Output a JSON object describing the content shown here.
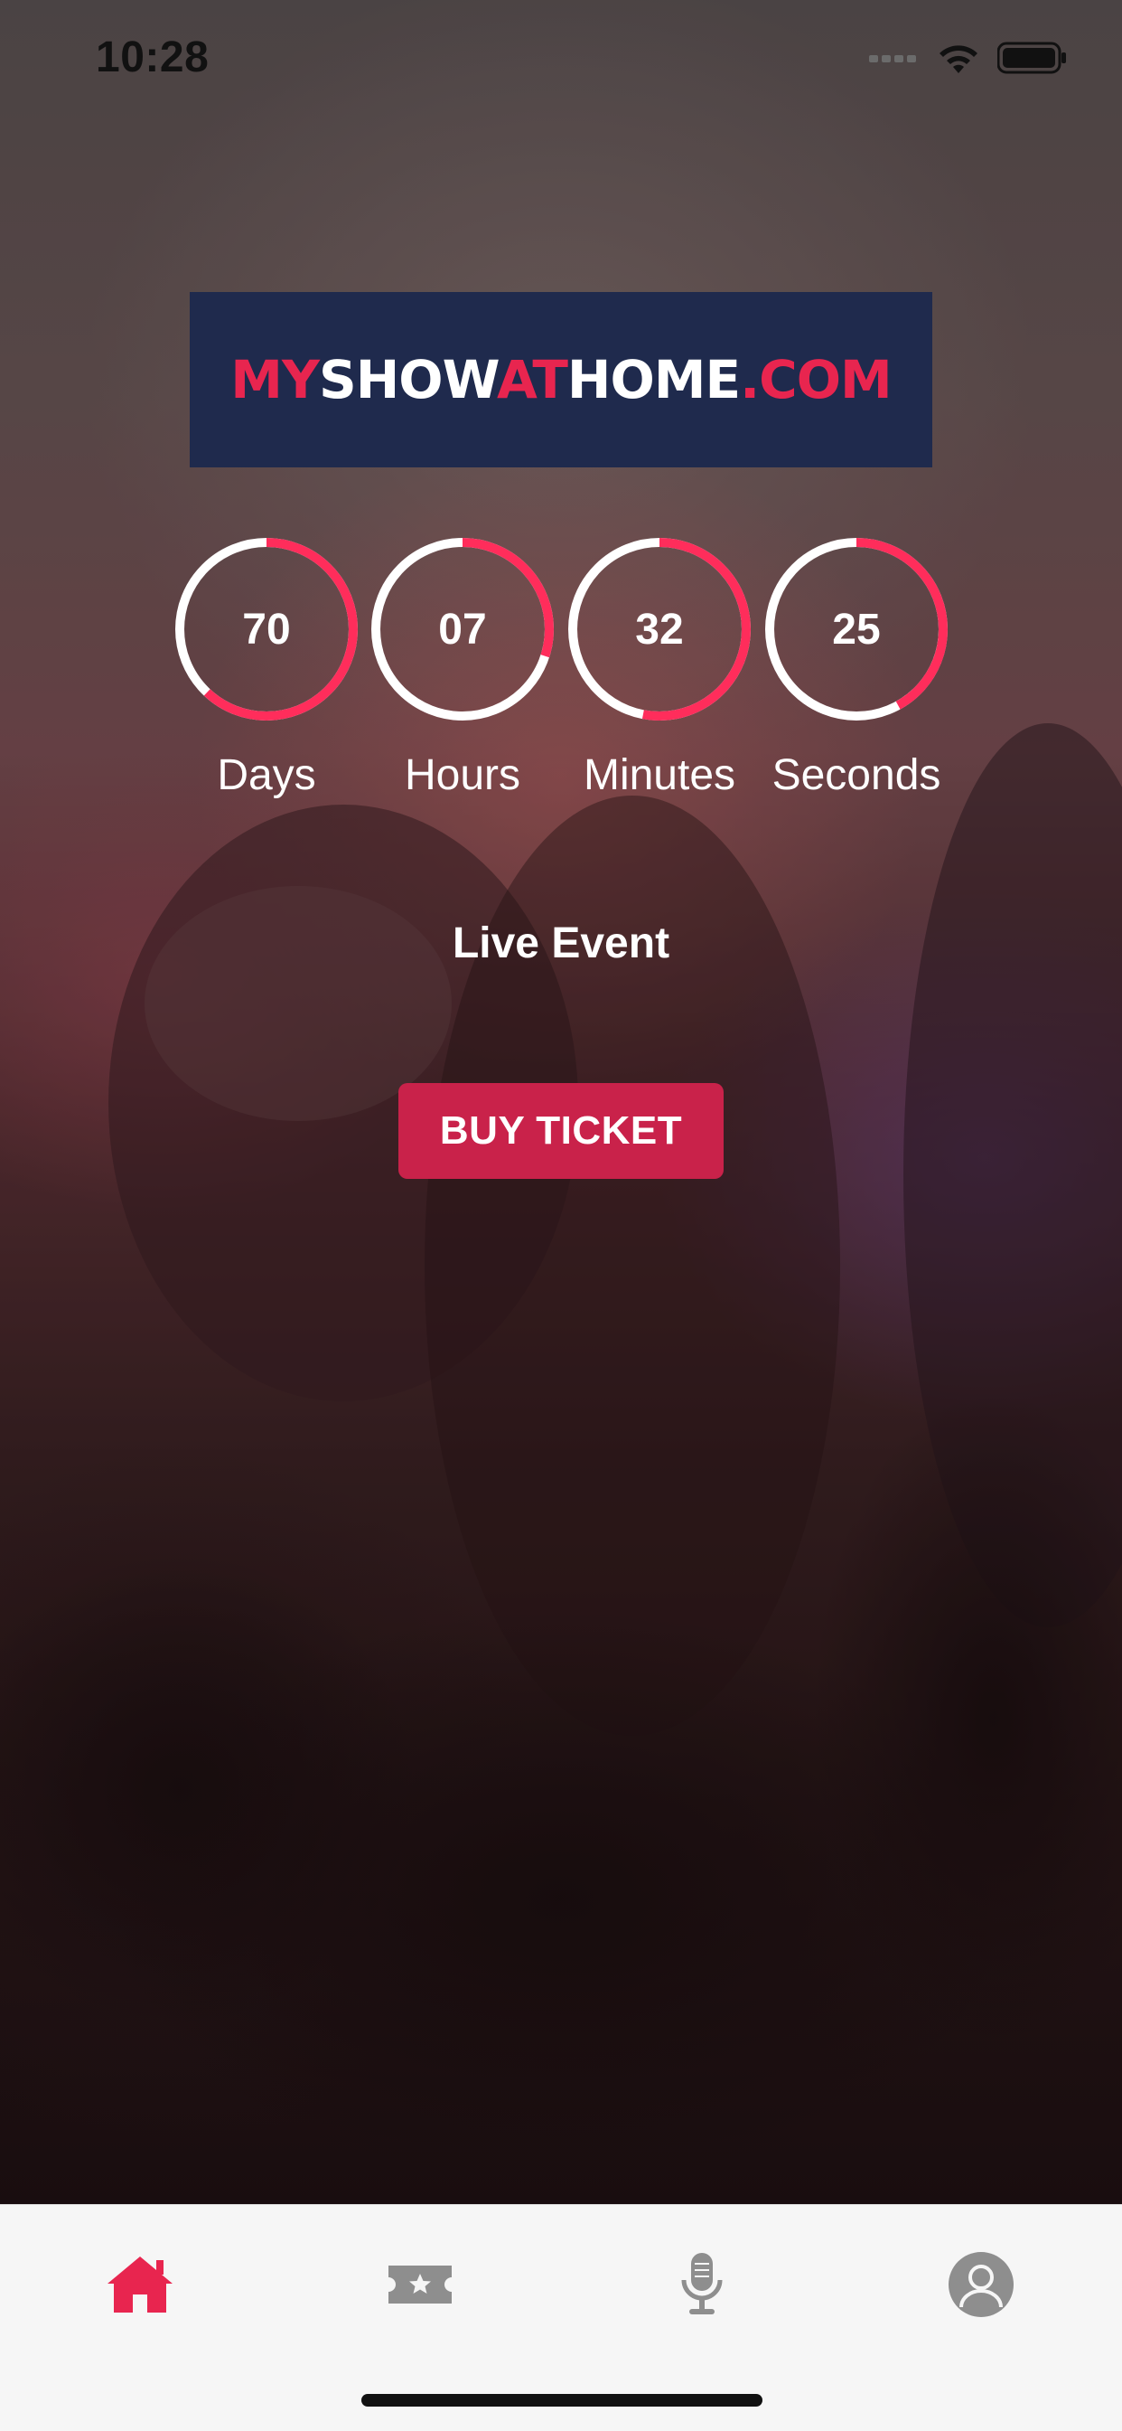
{
  "status_bar": {
    "time": "10:28",
    "icons": [
      "cellular-icon",
      "wifi-icon",
      "battery-icon"
    ]
  },
  "logo": {
    "parts": [
      {
        "text": "MY",
        "color": "#e8254f"
      },
      {
        "text": "SHOW",
        "color": "#ffffff"
      },
      {
        "text": "AT",
        "color": "#e8254f"
      },
      {
        "text": "HOME",
        "color": "#ffffff"
      },
      {
        "text": ".COM",
        "color": "#e8254f"
      }
    ],
    "background": "#1f2a4d"
  },
  "countdown": {
    "days": {
      "value": "70",
      "label": "Days",
      "progress": 0.62
    },
    "hours": {
      "value": "07",
      "label": "Hours",
      "progress": 0.3
    },
    "minutes": {
      "value": "32",
      "label": "Minutes",
      "progress": 0.53
    },
    "seconds": {
      "value": "25",
      "label": "Seconds",
      "progress": 0.42
    },
    "ring_color": "#ff2d5b",
    "track_color": "#ffffff"
  },
  "event": {
    "title": "Live Event",
    "buy_button_label": "BUY TICKET"
  },
  "tab_bar": {
    "tabs": [
      {
        "icon": "home-icon",
        "active": true
      },
      {
        "icon": "ticket-icon",
        "active": false
      },
      {
        "icon": "microphone-icon",
        "active": false
      },
      {
        "icon": "profile-icon",
        "active": false
      }
    ],
    "active_color": "#e8254f",
    "inactive_color": "#8e8e8e"
  }
}
